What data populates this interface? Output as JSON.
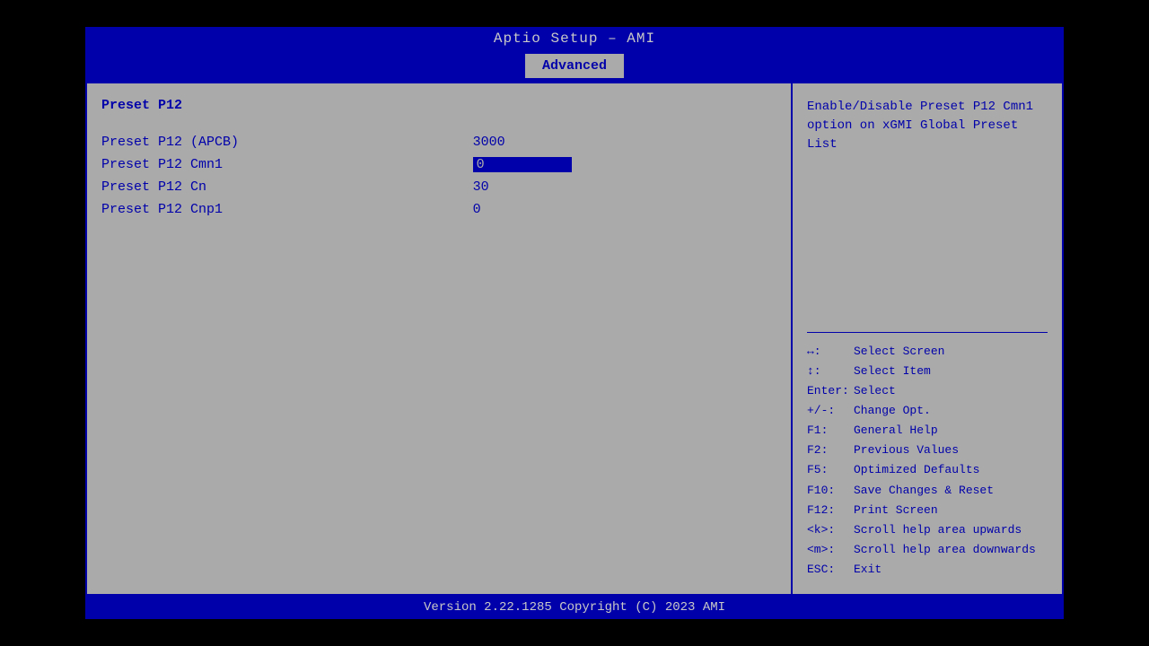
{
  "title": "Aptio Setup – AMI",
  "tabs": [
    {
      "label": "Advanced",
      "active": true
    }
  ],
  "left_panel": {
    "section_title": "Preset P12",
    "settings": [
      {
        "label": "Preset P12 (APCB)",
        "value": "3000",
        "selected": false
      },
      {
        "label": "Preset P12 Cmn1",
        "value": "0",
        "selected": true
      },
      {
        "label": "Preset P12 Cn",
        "value": "30",
        "selected": false
      },
      {
        "label": "Preset P12 Cnp1",
        "value": "0",
        "selected": false
      }
    ]
  },
  "right_panel": {
    "help_text": "Enable/Disable Preset P12 Cmn1 option on xGMI Global Preset List",
    "keys": [
      {
        "key": "↔:",
        "action": "Select Screen"
      },
      {
        "key": "↕:",
        "action": "Select Item"
      },
      {
        "key": "Enter:",
        "action": "Select"
      },
      {
        "key": "+/-:",
        "action": "Change Opt."
      },
      {
        "key": "F1:",
        "action": "General Help"
      },
      {
        "key": "F2:",
        "action": "Previous Values"
      },
      {
        "key": "F5:",
        "action": "Optimized Defaults"
      },
      {
        "key": "F10:",
        "action": "Save Changes & Reset"
      },
      {
        "key": "F12:",
        "action": "Print Screen"
      },
      {
        "key": "<k>:",
        "action": "Scroll help area upwards"
      },
      {
        "key": "<m>:",
        "action": "Scroll help area downwards"
      },
      {
        "key": "ESC:",
        "action": "Exit"
      }
    ]
  },
  "footer": {
    "text": "Version 2.22.1285 Copyright (C) 2023 AMI"
  }
}
